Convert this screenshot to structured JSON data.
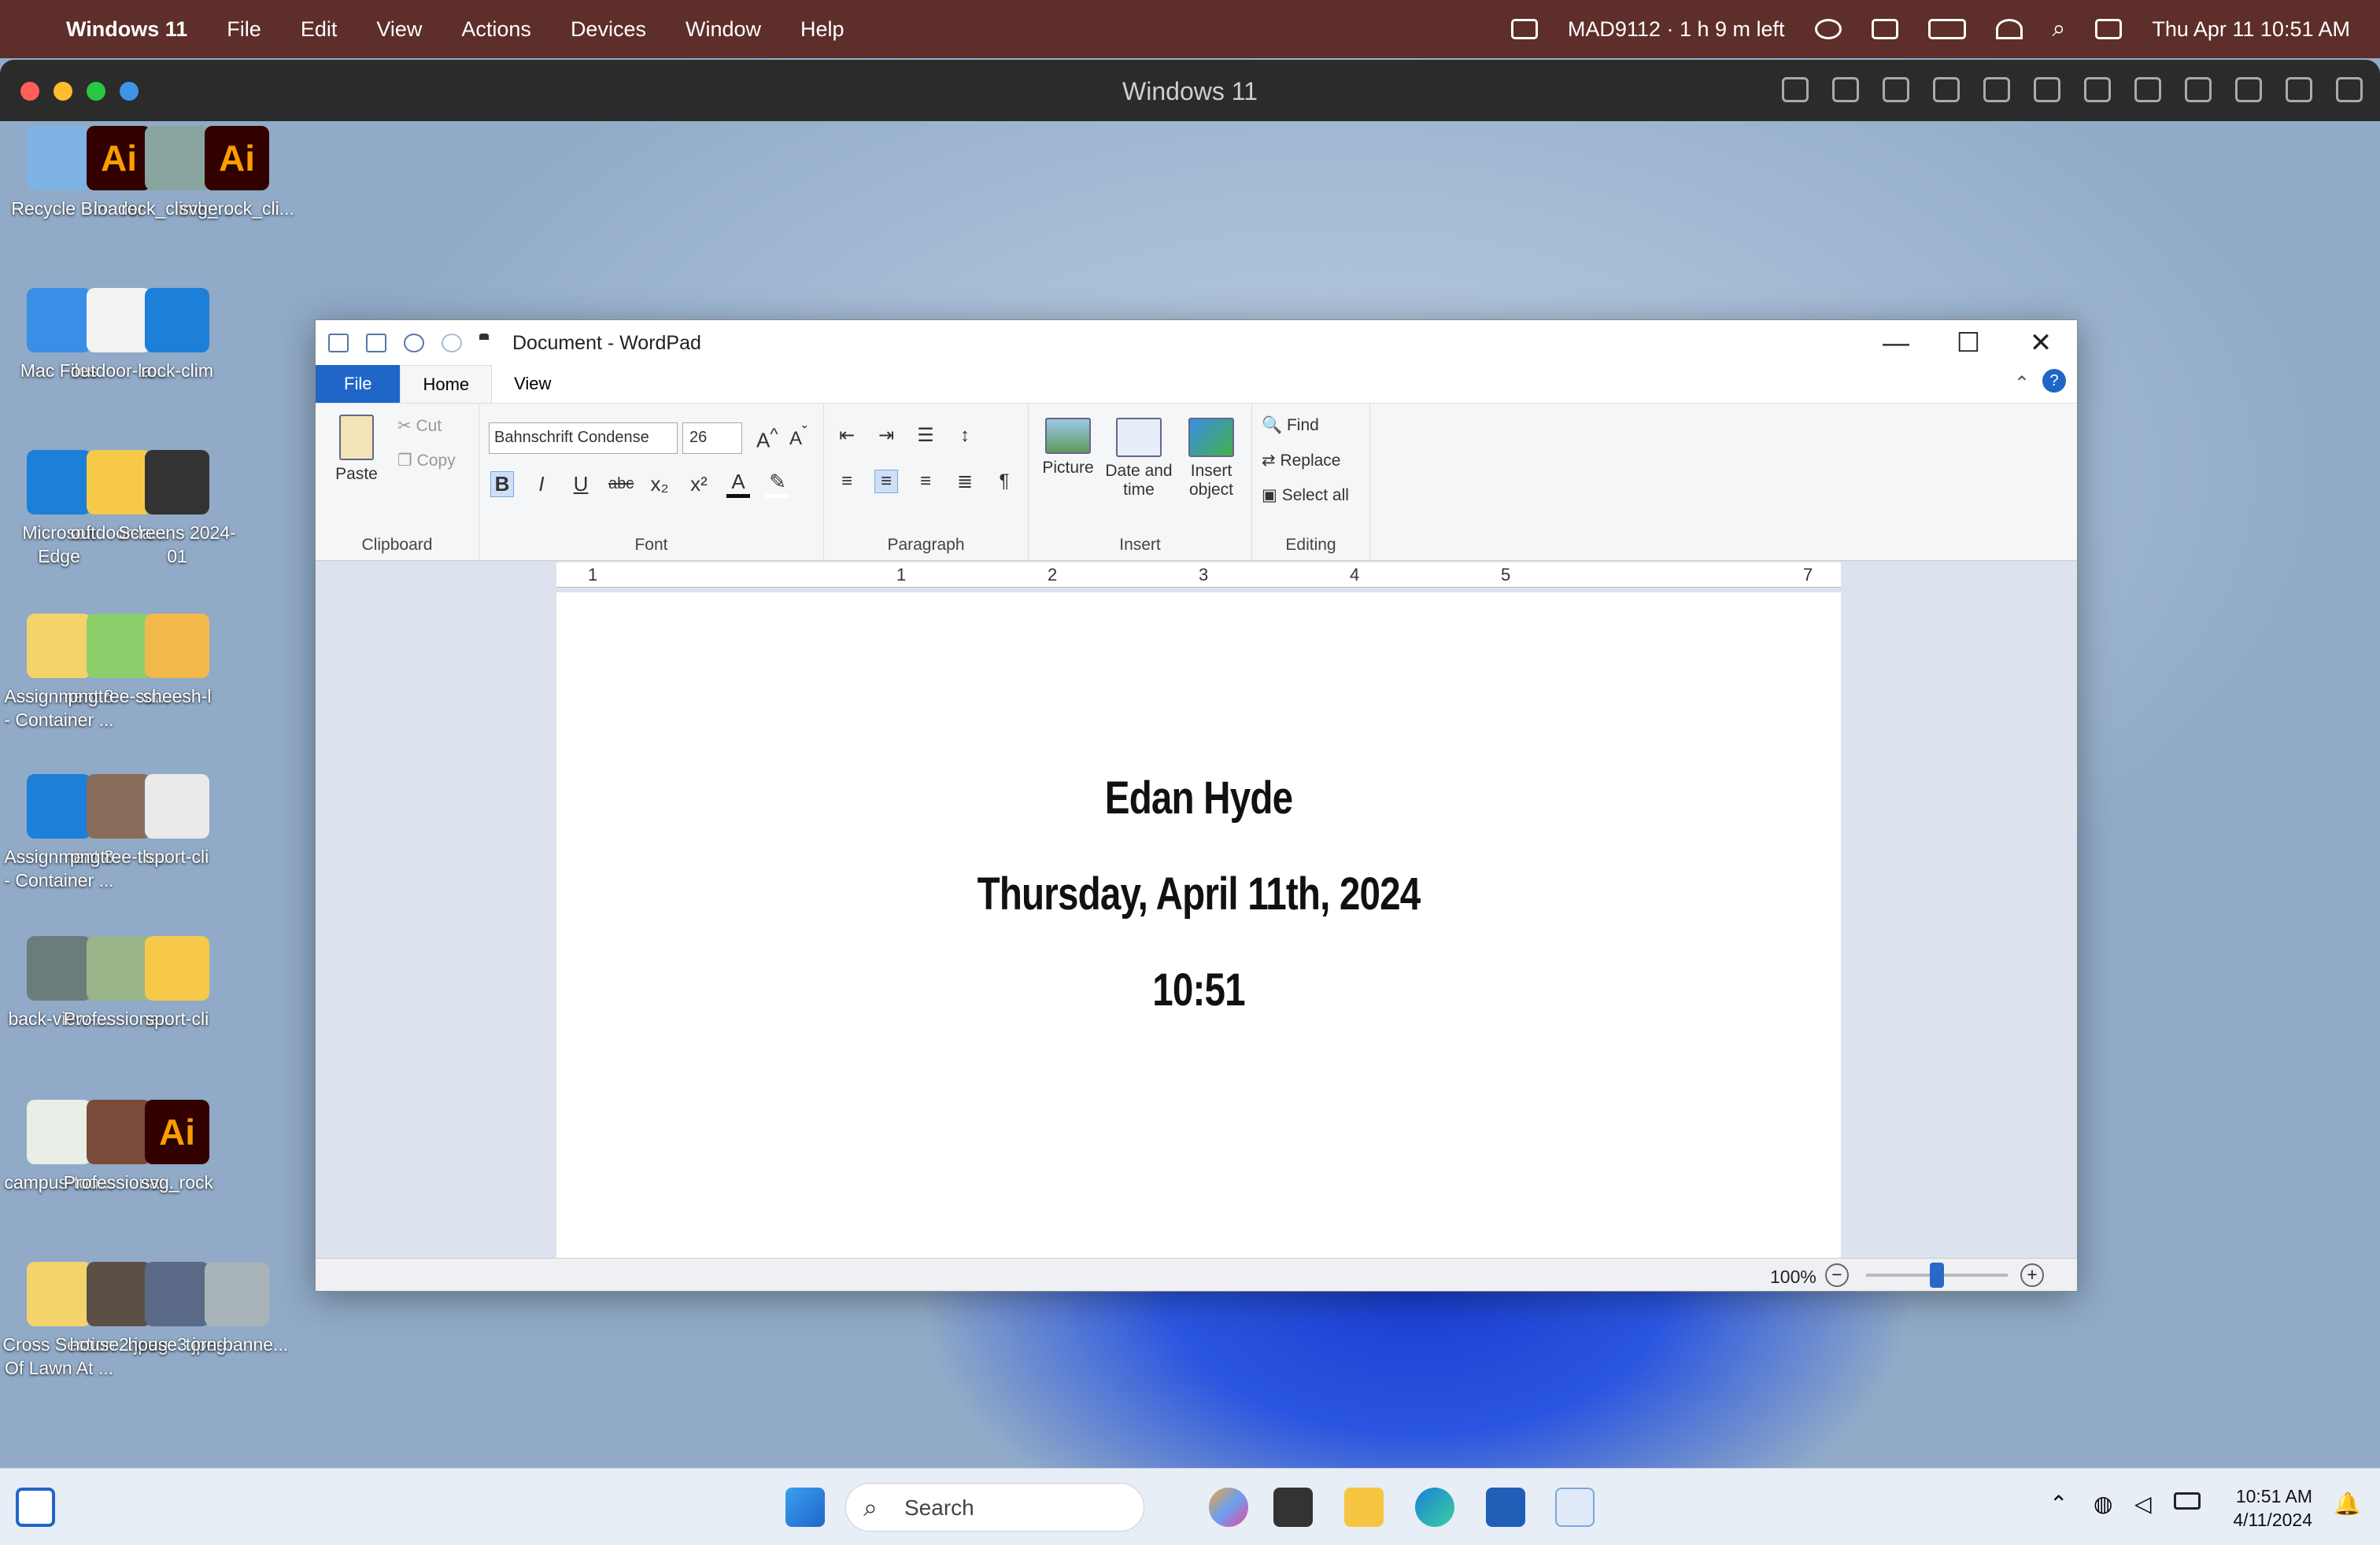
{
  "mac_menubar": {
    "app": "Windows 11",
    "items": [
      "File",
      "Edit",
      "View",
      "Actions",
      "Devices",
      "Window",
      "Help"
    ],
    "battery_text": "MAD9112 · 1 h 9 m left",
    "datetime": "Thu Apr 11  10:51 AM"
  },
  "parallels": {
    "title": "Windows 11"
  },
  "desktop_icons": [
    {
      "label": "Recycle Bin",
      "color": "#7fb3e6"
    },
    {
      "label": "loader",
      "color": "#330000",
      "ai": "Ai"
    },
    {
      "label": "rock_climbe...",
      "color": "#8aa4a0"
    },
    {
      "label": "svg_rock_cli...",
      "color": "#330000",
      "ai": "Ai"
    },
    {
      "label": "Mac Files",
      "color": "#3a8ee6"
    },
    {
      "label": "outdoor-la...",
      "color": "#f2f2f2"
    },
    {
      "label": "rock-clim",
      "color": "#1c7fd8"
    },
    {
      "label": "Microsoft Edge",
      "color": "#1c7fd8"
    },
    {
      "label": "outdoor-la...",
      "color": "#f7c948"
    },
    {
      "label": "Screens 2024-01",
      "color": "#333"
    },
    {
      "label": "Assignment 8 - Container ...",
      "color": "#f5d36b"
    },
    {
      "label": "pngtree-su...",
      "color": "#8ccf6a"
    },
    {
      "label": "sheesh-l",
      "color": "#f2b84b"
    },
    {
      "label": "Assignment 8 - Container ...",
      "color": "#1c7fd8"
    },
    {
      "label": "pngtree-th...",
      "color": "#8a6c5a"
    },
    {
      "label": "sport-cli",
      "color": "#eaeaea"
    },
    {
      "label": "back-view-...",
      "color": "#6b7c7a"
    },
    {
      "label": "Professiona...",
      "color": "#9ab58a"
    },
    {
      "label": "sport-cli",
      "color": "#f7c948"
    },
    {
      "label": "campus-tou...",
      "color": "#e9efe6"
    },
    {
      "label": "Professiona...",
      "color": "#7a4a3a"
    },
    {
      "label": "svg_rock",
      "color": "#330000",
      "ai": "Ai"
    },
    {
      "label": "Cross Section Of Lawn At ...",
      "color": "#f5d36b"
    },
    {
      "label": "house2.jpeg",
      "color": "#5a5046"
    },
    {
      "label": "house3.jpeg",
      "color": "#5a6a86"
    },
    {
      "label": "torn-banne...",
      "color": "#a8b4b8"
    }
  ],
  "wordpad": {
    "title": "Document - WordPad",
    "tabs": {
      "file": "File",
      "home": "Home",
      "view": "View"
    },
    "clipboard": {
      "paste": "Paste",
      "cut": "Cut",
      "copy": "Copy",
      "label": "Clipboard"
    },
    "font": {
      "name": "Bahnschrift Condense",
      "size": "26",
      "label": "Font"
    },
    "paragraph": {
      "label": "Paragraph"
    },
    "insert": {
      "picture": "Picture",
      "datetime1": "Date and",
      "datetime2": "time",
      "object1": "Insert",
      "object2": "object",
      "label": "Insert"
    },
    "editing": {
      "find": "Find",
      "replace": "Replace",
      "select_all": "Select all",
      "label": "Editing"
    },
    "ruler": [
      "1",
      "1",
      "2",
      "3",
      "4",
      "5",
      "7"
    ],
    "document_lines": [
      "Edan Hyde",
      "Thursday, April 11th, 2024",
      "10:51"
    ],
    "zoom": "100%",
    "zoom_fraction": 0.5
  },
  "taskbar": {
    "search": "Search",
    "time": "10:51 AM",
    "date": "4/11/2024"
  }
}
